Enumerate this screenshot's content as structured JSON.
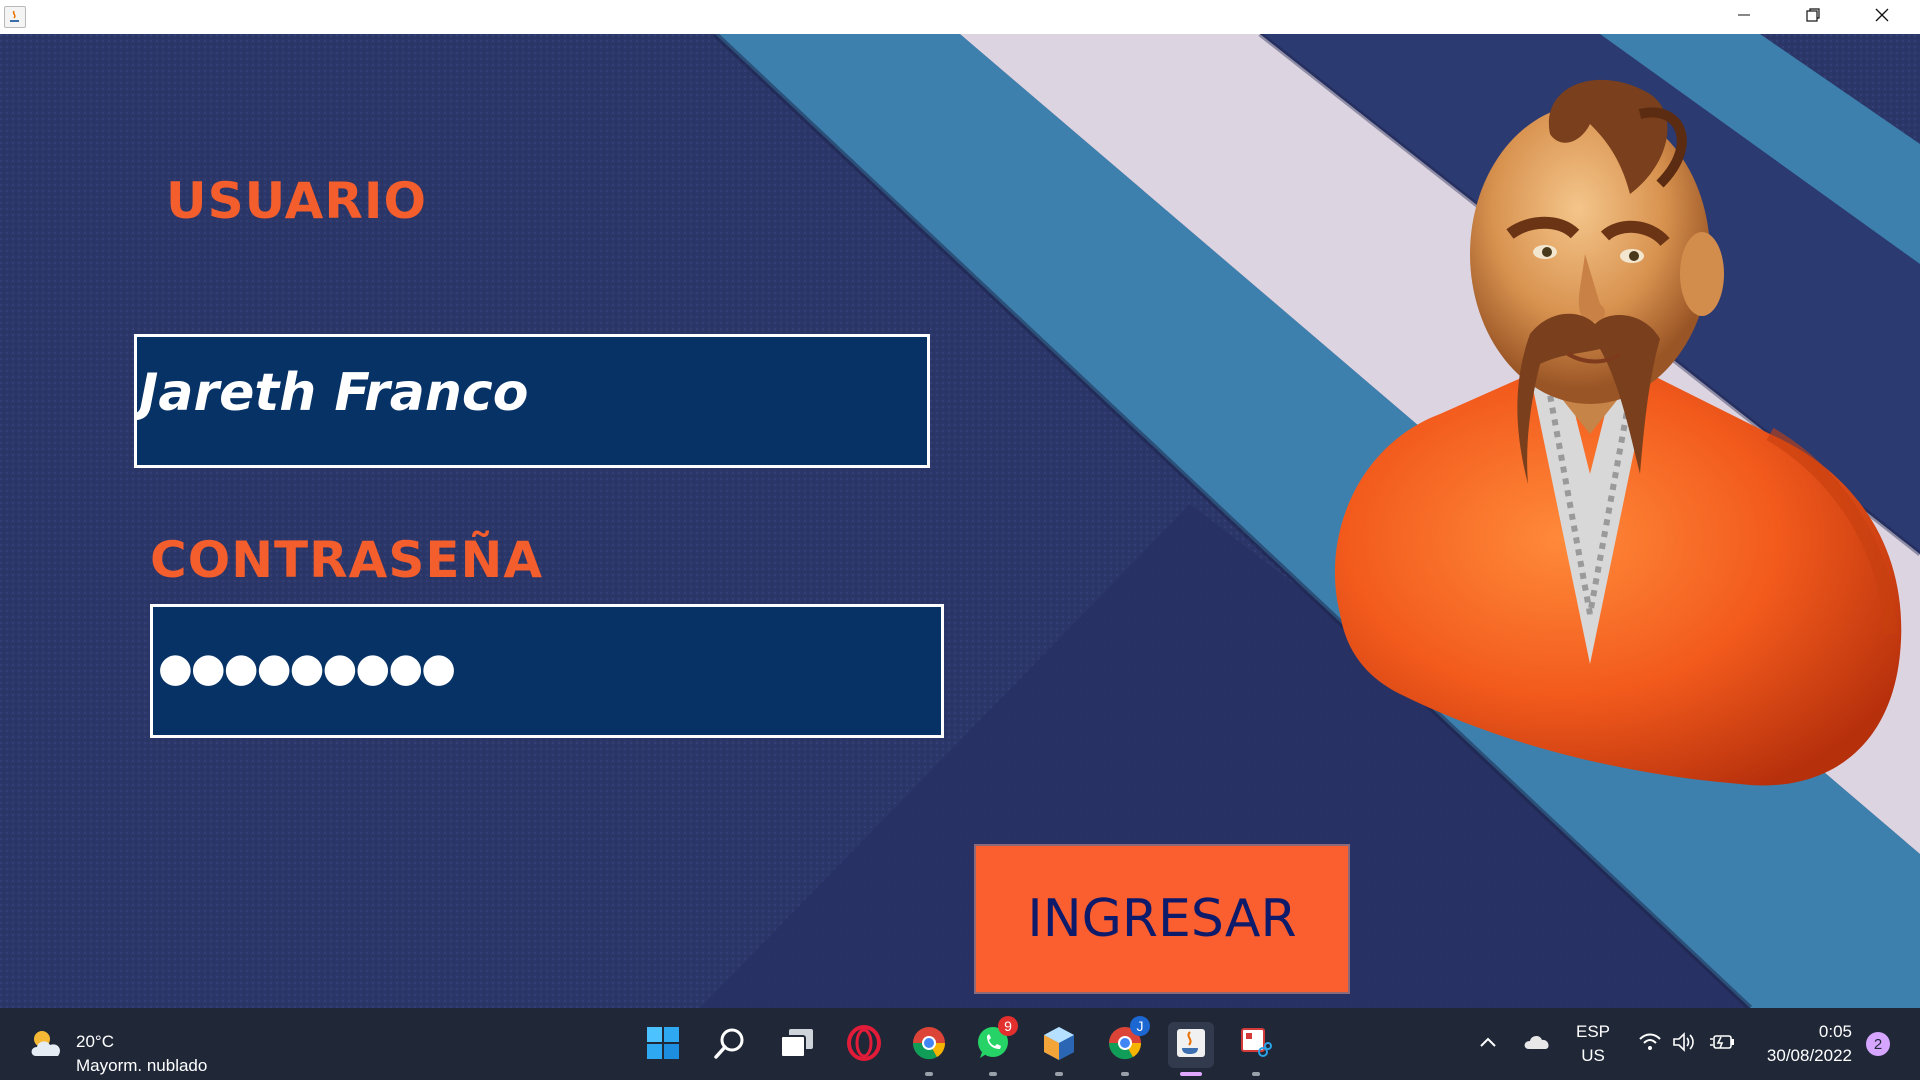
{
  "window": {
    "controls": {
      "minimize_icon": "minimize-icon",
      "maximize_icon": "restore-icon",
      "close_icon": "close-icon"
    }
  },
  "form": {
    "username_label": "USUARIO",
    "username_value": "Jareth Franco",
    "password_label": "CONTRASEÑA",
    "password_mask": "●●●●●●●●●",
    "submit_label": "INGRESAR"
  },
  "colors": {
    "label_orange": "#f45d2c",
    "field_navy": "#063266",
    "button_orange": "#fb5f2f",
    "button_text": "#0e1a6a",
    "background_navy": "#2b3568",
    "stripe_teal": "#3d80ad",
    "stripe_lavender": "#ddd4e2"
  },
  "taskbar": {
    "weather": {
      "temp": "20°C",
      "desc": "Mayorm. nublado",
      "icon": "partly-cloudy-icon"
    },
    "apps": [
      {
        "name": "start",
        "icon": "windows-start-icon"
      },
      {
        "name": "search",
        "icon": "search-icon"
      },
      {
        "name": "task-view",
        "icon": "task-view-icon"
      },
      {
        "name": "opera",
        "icon": "opera-icon"
      },
      {
        "name": "chrome",
        "icon": "chrome-icon"
      },
      {
        "name": "whatsapp",
        "icon": "whatsapp-icon",
        "badge": "9"
      },
      {
        "name": "netbeans",
        "icon": "netbeans-icon"
      },
      {
        "name": "chrome-profile",
        "icon": "chrome-icon",
        "badge": "J"
      },
      {
        "name": "java",
        "icon": "java-icon"
      },
      {
        "name": "snipping-tool",
        "icon": "snipping-tool-icon"
      }
    ],
    "tray": {
      "language": "ESP",
      "layout": "US",
      "time": "0:05",
      "date": "30/08/2022",
      "notifications": "2"
    }
  }
}
